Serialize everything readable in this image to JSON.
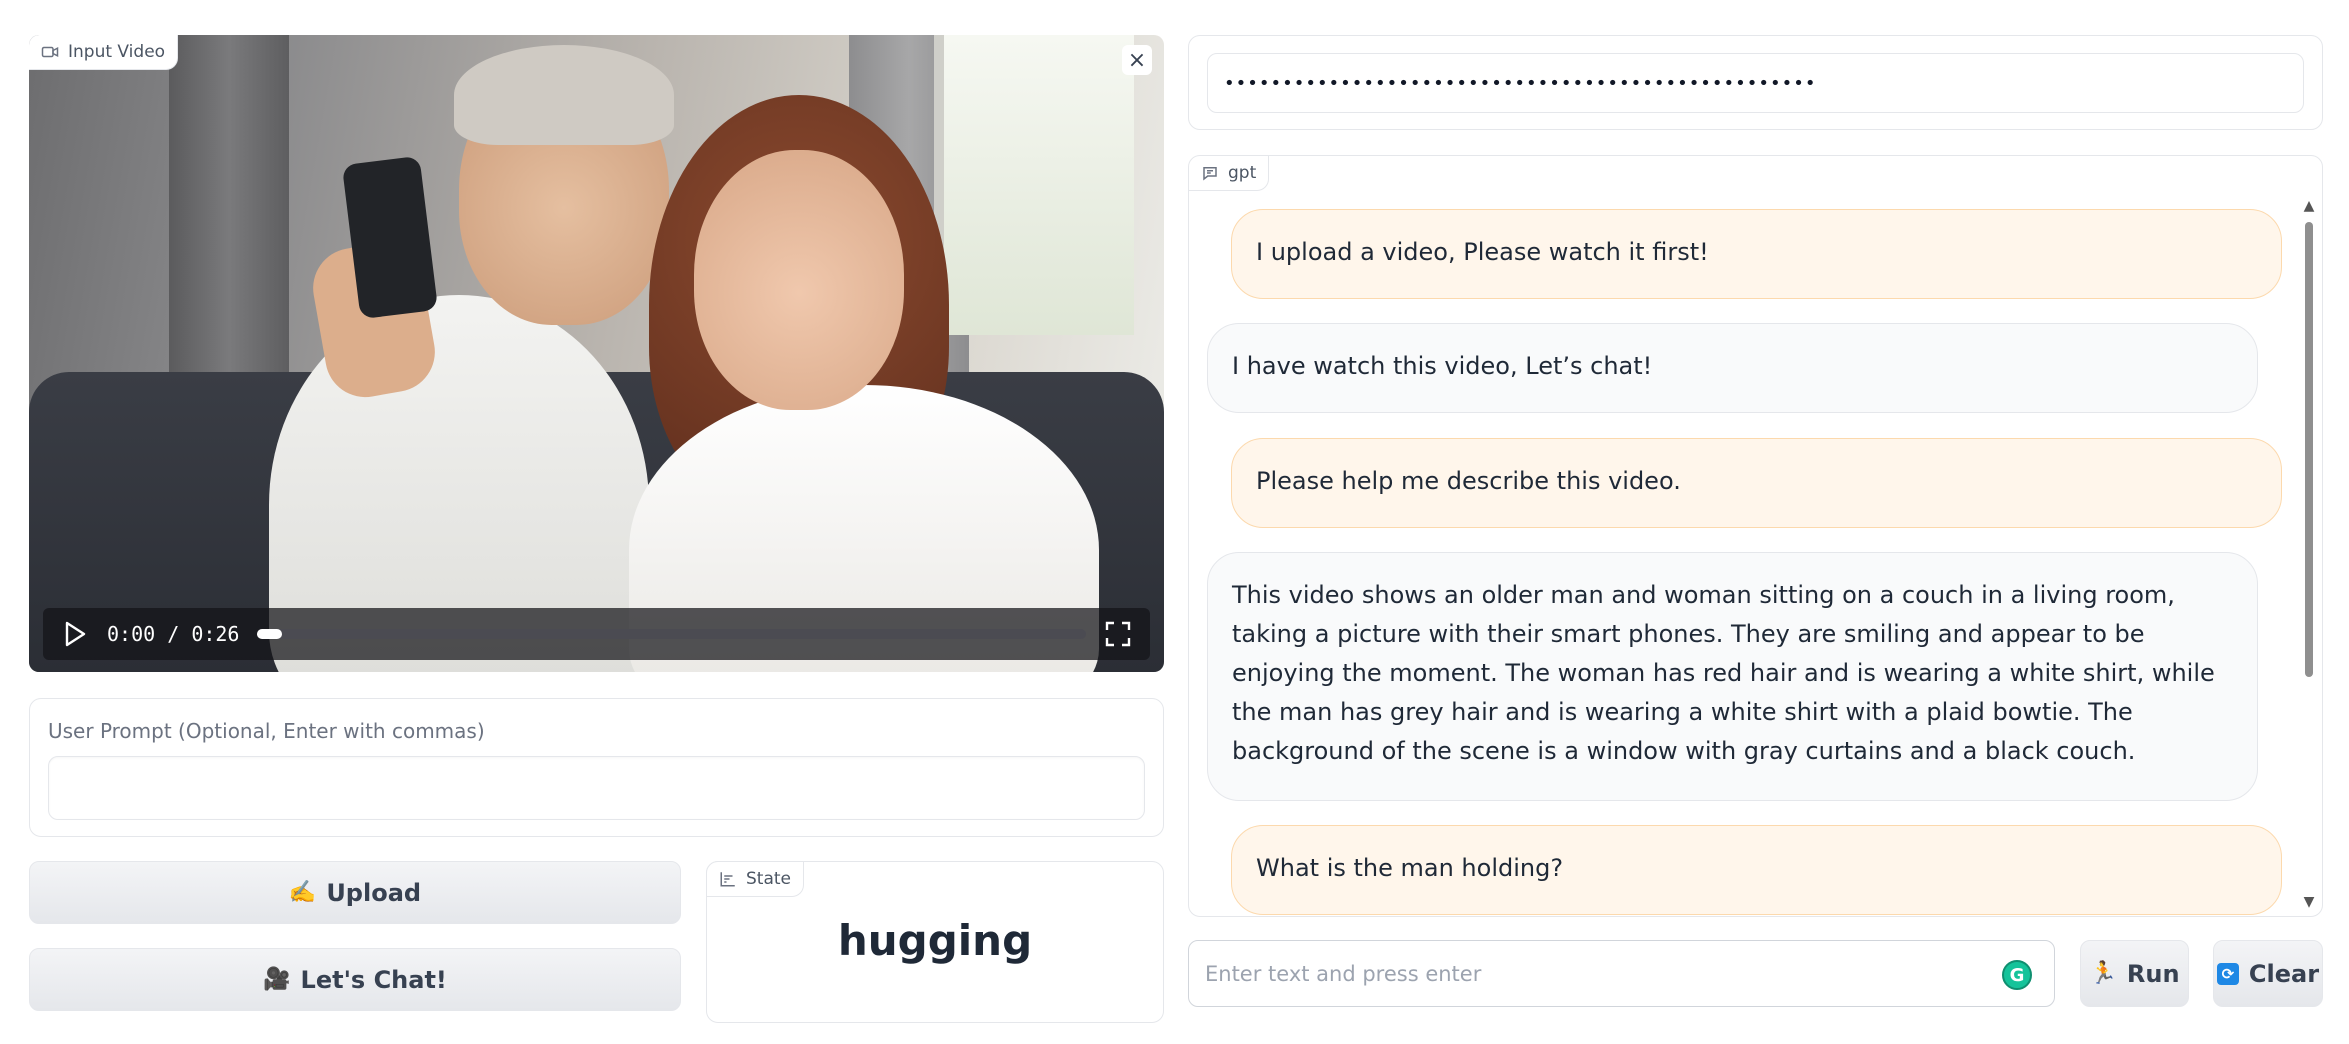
{
  "video": {
    "label": "Input Video",
    "current_time": "0:00",
    "separator": "/",
    "duration": "0:26",
    "progress_fraction": 0.03,
    "close_icon": "×",
    "play_icon": "play-icon",
    "fullscreen_icon": "fullscreen-icon"
  },
  "prompt": {
    "label": "User Prompt (Optional, Enter with commas)",
    "value": ""
  },
  "buttons": {
    "upload_emoji": "✍️",
    "upload_label": "Upload",
    "chat_emoji": "🎥",
    "chat_label": "Let's Chat!",
    "run_emoji": "🏃",
    "run_label": "Run",
    "clear_emoji": "🔄",
    "clear_label": "Clear"
  },
  "state": {
    "label": "State",
    "value": "hugging"
  },
  "api_key": {
    "masked_value": "•••••••••••••••••••••••••••••••••••••••••••••••••••"
  },
  "chat": {
    "label": "gpt",
    "messages": [
      {
        "role": "user",
        "text": "I upload a video, Please watch it first!"
      },
      {
        "role": "bot",
        "text": "I have watch this video, Let’s chat!"
      },
      {
        "role": "user",
        "text": "Please help me describe this video."
      },
      {
        "role": "bot",
        "text": "This video shows an older man and woman sitting on a couch in a living room, taking a picture with their smart phones. They are smiling and appear to be enjoying the moment. The woman has red hair and is wearing a white shirt, while the man has grey hair and is wearing a white shirt with a plaid bowtie. The background of the scene is a window with gray curtains and a black couch."
      },
      {
        "role": "user",
        "text": "What is the man holding?"
      }
    ]
  },
  "text_input": {
    "placeholder": "Enter text and press enter"
  },
  "colors": {
    "user_bubble": "#fff6eb",
    "user_border": "#fcd9ad",
    "bot_bubble": "#f9fafb",
    "clear_icon": "#1e88e5",
    "grammarly": "#15c39a"
  }
}
